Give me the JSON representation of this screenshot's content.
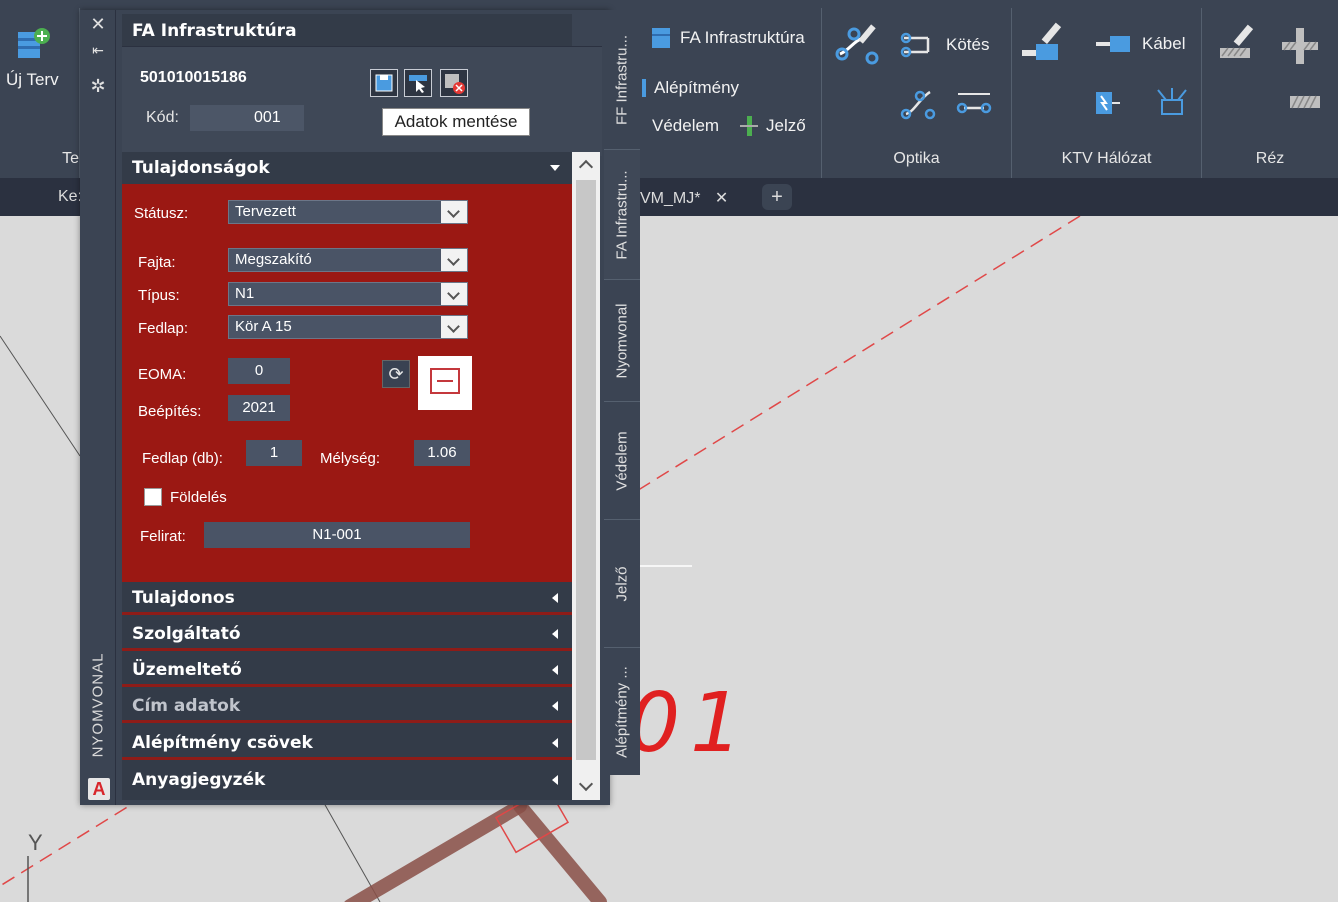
{
  "ribbon": {
    "new_plan_label": "Új Terv",
    "panel_left_label": "Te",
    "infra_label": "FA Infrastruktúra",
    "alepitmeny_label": "Alépítmény",
    "vedelem_label": "Védelem",
    "jelzo_label": "Jelző",
    "kotes_label": "Kötés",
    "kabel_label": "Kábel",
    "groups": [
      "Optika",
      "KTV Hálózat",
      "Réz"
    ]
  },
  "tabs": {
    "left_tab": "Ke:",
    "drawing_tab": "VM_MJ*",
    "close_glyph": "✕",
    "add_glyph": "+"
  },
  "canvas": {
    "annotation_text": "01",
    "axis_label": "Y"
  },
  "palette": {
    "title": "FA Infrastruktúra",
    "strip_close": "✕",
    "strip_pin": "⇤",
    "strip_settings": "✲",
    "side_label": "NYOMVONAL",
    "logo": "A",
    "id_number": "501010015186",
    "kod_label": "Kód:",
    "kod_value": "001",
    "tooltip": "Adatok mentése",
    "properties": {
      "header": "Tulajdonságok",
      "status_label": "Státusz:",
      "status_value": "Tervezett",
      "fajta_label": "Fajta:",
      "fajta_value": "Megszakító",
      "tipus_label": "Típus:",
      "tipus_value": "N1",
      "fedlap_label": "Fedlap:",
      "fedlap_value": "Kör A 15",
      "eoma_label": "EOMA:",
      "eoma_value": "0",
      "refresh_glyph": "⟳",
      "beepites_label": "Beépítés:",
      "beepites_value": "2021",
      "fedlap_db_label": "Fedlap (db):",
      "fedlap_db_value": "1",
      "melyseg_label": "Mélység:",
      "melyseg_value": "1.06",
      "foldeles_label": "Földelés",
      "felirat_label": "Felirat:",
      "felirat_value": "N1-001"
    },
    "sections": [
      "Tulajdonos",
      "Szolgáltató",
      "Üzemeltető",
      "Cím adatok",
      "Alépítmény csövek",
      "Anyagjegyzék"
    ],
    "vertical_tabs": [
      "FF Infrastru...",
      "FA Infrastru...",
      "Nyomvonal",
      "Védelem",
      "Jelző",
      "Alépítmény ..."
    ]
  },
  "colors": {
    "ribbon_bg": "#3b4453",
    "panel_bg": "#333b48",
    "properties_bg": "#9b1813",
    "canvas_bg": "#dadada",
    "dashed_line": "#e04848",
    "annotation_red": "#e02020",
    "pipe_brown": "#8a5048"
  }
}
